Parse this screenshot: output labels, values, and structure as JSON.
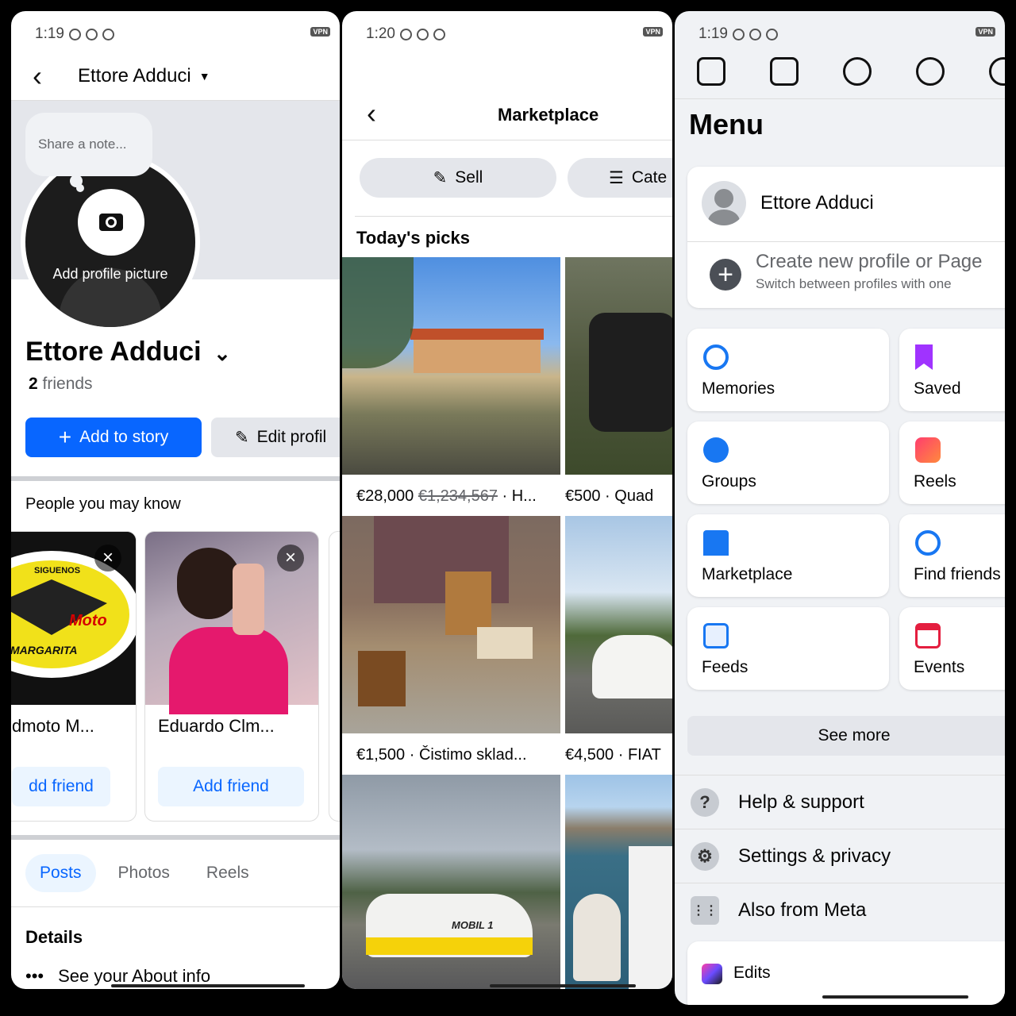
{
  "profile_panel": {
    "status": {
      "time": "1:19"
    },
    "header": {
      "title": "Ettore Adduci"
    },
    "note_placeholder": "Share a note...",
    "avatar_label": "Add profile picture",
    "name": "Ettore Adduci",
    "friend_count": "2",
    "friends_word": "friends",
    "add_story": "Add to story",
    "edit_profile": "Edit profil",
    "pymk_title": "People you may know",
    "suggestions": [
      {
        "name": "dmoto M...",
        "action": "dd friend"
      },
      {
        "name": "Eduardo Clm...",
        "action": "Add friend"
      }
    ],
    "badge_text": {
      "top": "SIGUENOS",
      "mid": "Moto",
      "bottom": "MARGARITA"
    },
    "tabs": [
      "Posts",
      "Photos",
      "Reels"
    ],
    "details_title": "Details",
    "about": "See your About info"
  },
  "marketplace_panel": {
    "status": {
      "time": "1:20"
    },
    "title": "Marketplace",
    "sell": "Sell",
    "categories": "Cate",
    "section": "Today's picks",
    "listings": [
      {
        "price": "€28,000",
        "old_price": "€1,234,567",
        "title": " · H..."
      },
      {
        "price": "€500",
        "title": " · Quad"
      },
      {
        "price": "€1,500",
        "title": " · Čistimo sklad..."
      },
      {
        "price": "€4,500",
        "title": " · FIAT"
      }
    ],
    "car_label": "MOBIL 1"
  },
  "menu_panel": {
    "status": {
      "time": "1:19"
    },
    "title": "Menu",
    "profile_name": "Ettore Adduci",
    "create_profile": "Create new profile or Page",
    "switch_profiles": "Switch between profiles with one",
    "shortcuts": [
      {
        "label": "Memories",
        "icon": "clock-icon",
        "color": "#1877f2"
      },
      {
        "label": "Saved",
        "icon": "bookmark-icon",
        "color": "#a033ff"
      },
      {
        "label": "Groups",
        "icon": "groups-icon",
        "color": "#1877f2"
      },
      {
        "label": "Reels",
        "icon": "reels-icon",
        "color": "#ff4d6d"
      },
      {
        "label": "Marketplace",
        "icon": "shop-icon",
        "color": "#1877f2"
      },
      {
        "label": "Find friends",
        "icon": "search-people-icon",
        "color": "#1877f2"
      },
      {
        "label": "Feeds",
        "icon": "feeds-icon",
        "color": "#1877f2"
      },
      {
        "label": "Events",
        "icon": "calendar-icon",
        "color": "#e41e3f"
      }
    ],
    "see_more": "See more",
    "rows": [
      {
        "label": "Help & support",
        "glyph": "?"
      },
      {
        "label": "Settings & privacy",
        "glyph": "⚙"
      },
      {
        "label": "Also from Meta",
        "glyph": "⋮⋮"
      }
    ],
    "edits": "Edits"
  },
  "colors": {
    "accent": "#0866ff",
    "light_accent": "#ebf5ff",
    "panel_bg": "#f0f2f5"
  }
}
